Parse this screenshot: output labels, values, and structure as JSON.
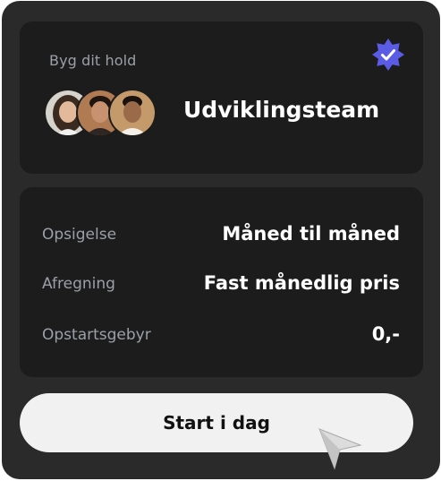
{
  "team_card": {
    "eyebrow": "Byg dit hold",
    "team_name": "Udviklingsteam",
    "verified_icon": "verified-badge-icon"
  },
  "details": {
    "rows": [
      {
        "label": "Opsigelse",
        "value": "Måned til måned"
      },
      {
        "label": "Afregning",
        "value": "Fast månedlig pris"
      },
      {
        "label": "Opstartsgebyr",
        "value": "0,-"
      }
    ]
  },
  "cta": {
    "label": "Start i dag"
  },
  "colors": {
    "card_bg": "#2a2a2a",
    "panel_bg": "#1c1c1c",
    "accent": "#5b5ce6",
    "button_bg": "#f1f1f1",
    "muted_text": "#9aa0a6"
  }
}
